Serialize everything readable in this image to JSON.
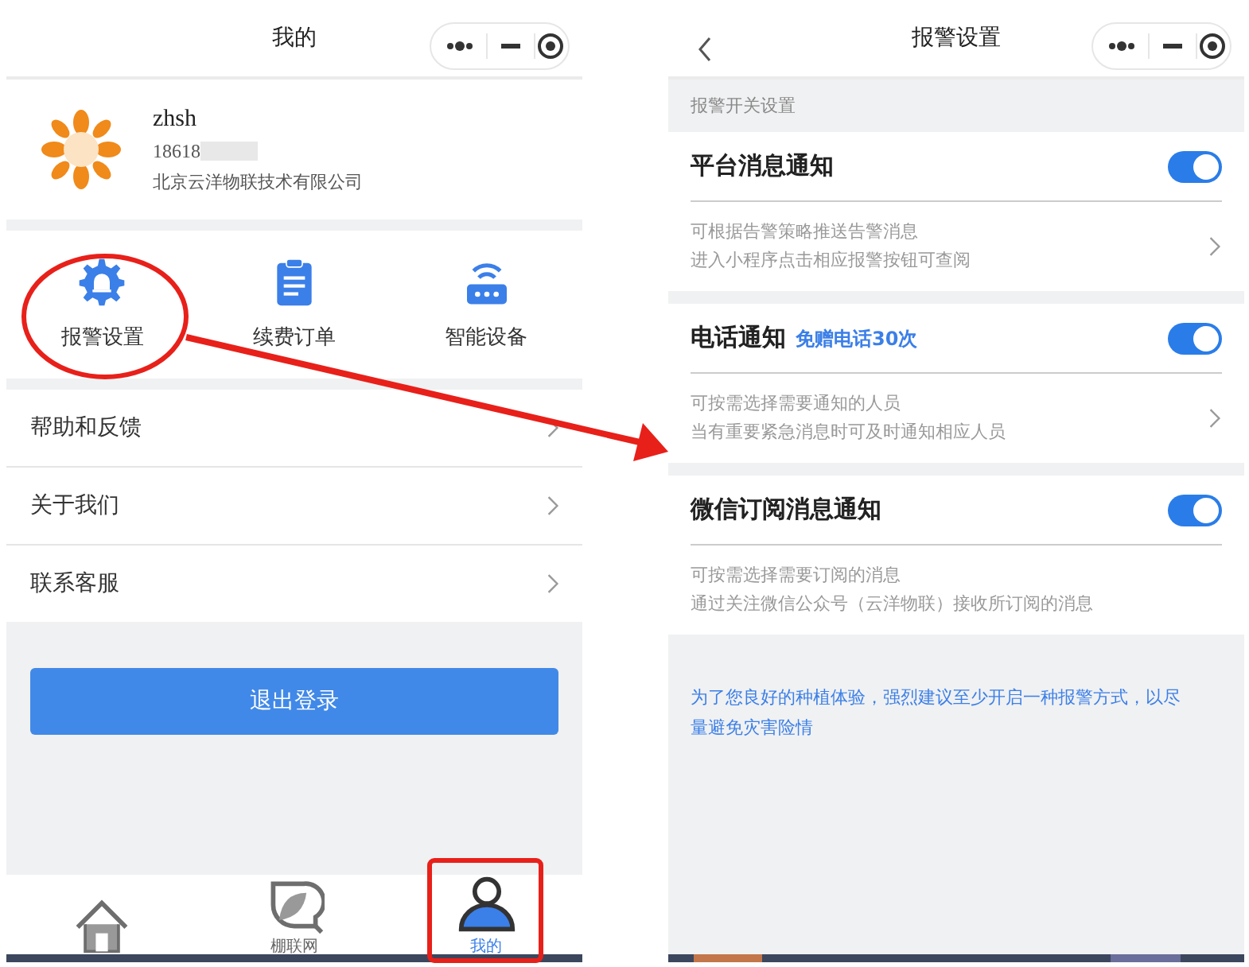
{
  "left_screen": {
    "title": "我的",
    "profile": {
      "name": "zhsh",
      "phone": "18618",
      "company": "北京云洋物联技术有限公司"
    },
    "shortcuts": [
      {
        "kind": "alarm",
        "label": "报警设置"
      },
      {
        "kind": "order",
        "label": "续费订单"
      },
      {
        "kind": "device",
        "label": "智能设备"
      }
    ],
    "menu": [
      {
        "label": "帮助和反馈"
      },
      {
        "label": "关于我们"
      },
      {
        "label": "联系客服"
      }
    ],
    "logout_button": "退出登录",
    "tab_bar": [
      {
        "kind": "home",
        "selected": false
      },
      {
        "kind": "leaf",
        "label": "棚联网",
        "selected": false
      },
      {
        "kind": "user",
        "label": "我的",
        "selected": true
      }
    ]
  },
  "right_screen": {
    "title": "报警设置",
    "section_label": "报警开关设置",
    "settings": [
      {
        "title": "平台消息通知",
        "on": true,
        "kind": "link",
        "lines": [
          "可根据告警策略推送告警消息",
          "进入小程序点击相应报警按钮可查阅"
        ]
      },
      {
        "title": "电话通知",
        "badge": "免赠电话30次",
        "on": true,
        "kind": "link",
        "lines": [
          "可按需选择需要通知的人员",
          "当有重要紧急消息时可及时通知相应人员"
        ]
      },
      {
        "title": "微信订阅消息通知",
        "on": true,
        "kind": "plain",
        "lines": [
          "可按需选择需要订阅的消息",
          "通过关注微信公众号（云洋物联）接收所订阅的消息"
        ]
      }
    ],
    "note": "为了您良好的种植体验，强烈建议至少开启一种报警方式，以尽量避免灾害险情"
  }
}
